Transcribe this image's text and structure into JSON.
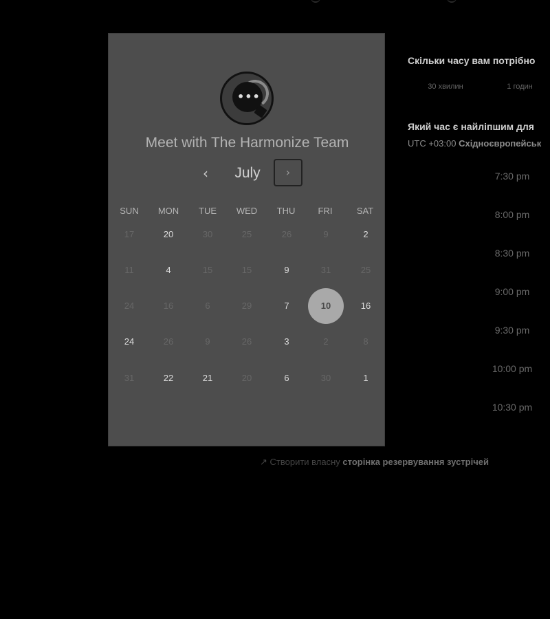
{
  "booking_card": {
    "title": "Meet with The Harmonize Team",
    "month": "July",
    "prev_icon": "‹",
    "next_icon": "›",
    "logo_icon": "chat-bubble-logo",
    "weekdays": [
      "SUN",
      "MON",
      "TUE",
      "WED",
      "THU",
      "FRI",
      "SAT"
    ],
    "weeks": [
      [
        {
          "d": "17",
          "s": "muted"
        },
        {
          "d": "20",
          "s": "available"
        },
        {
          "d": "30",
          "s": "muted"
        },
        {
          "d": "25",
          "s": "muted"
        },
        {
          "d": "26",
          "s": "muted"
        },
        {
          "d": "9",
          "s": "muted"
        },
        {
          "d": "2",
          "s": "available"
        }
      ],
      [
        {
          "d": "11",
          "s": "muted"
        },
        {
          "d": "4",
          "s": "available"
        },
        {
          "d": "15",
          "s": "muted"
        },
        {
          "d": "15",
          "s": "muted"
        },
        {
          "d": "9",
          "s": "available"
        },
        {
          "d": "31",
          "s": "muted"
        },
        {
          "d": "25",
          "s": "muted"
        }
      ],
      [
        {
          "d": "24",
          "s": "muted"
        },
        {
          "d": "16",
          "s": "muted"
        },
        {
          "d": "6",
          "s": "muted"
        },
        {
          "d": "29",
          "s": "muted"
        },
        {
          "d": "7",
          "s": "available"
        },
        {
          "d": "10",
          "s": "selected"
        },
        {
          "d": "16",
          "s": "available"
        }
      ],
      [
        {
          "d": "24",
          "s": "available"
        },
        {
          "d": "26",
          "s": "muted"
        },
        {
          "d": "9",
          "s": "muted"
        },
        {
          "d": "26",
          "s": "muted"
        },
        {
          "d": "3",
          "s": "available"
        },
        {
          "d": "2",
          "s": "muted"
        },
        {
          "d": "8",
          "s": "muted"
        }
      ],
      [
        {
          "d": "31",
          "s": "muted"
        },
        {
          "d": "22",
          "s": "available"
        },
        {
          "d": "21",
          "s": "available"
        },
        {
          "d": "20",
          "s": "muted"
        },
        {
          "d": "6",
          "s": "available"
        },
        {
          "d": "30",
          "s": "muted"
        },
        {
          "d": "1",
          "s": "available"
        }
      ]
    ]
  },
  "duration_section": {
    "question": "Скільки часу вам потрібно",
    "options": [
      "30 хвилин",
      "1 годин"
    ]
  },
  "time_section": {
    "question": "Який час є найліпшим для",
    "timezone_offset": "UTC +03:00",
    "timezone_name": "Східноєвропейськ",
    "slots": [
      "7:30 pm",
      "8:00 pm",
      "8:30 pm",
      "9:00 pm",
      "9:30 pm",
      "10:00 pm",
      "10:30 pm"
    ]
  },
  "footer": {
    "icon": "external-link-icon",
    "prefix": "Створити власну",
    "link": "сторінка резервування зустрічей"
  },
  "colors": {
    "page_bg": "#000000",
    "card_bg": "#4d4d4d",
    "selected_day": "#a9a9a9"
  }
}
